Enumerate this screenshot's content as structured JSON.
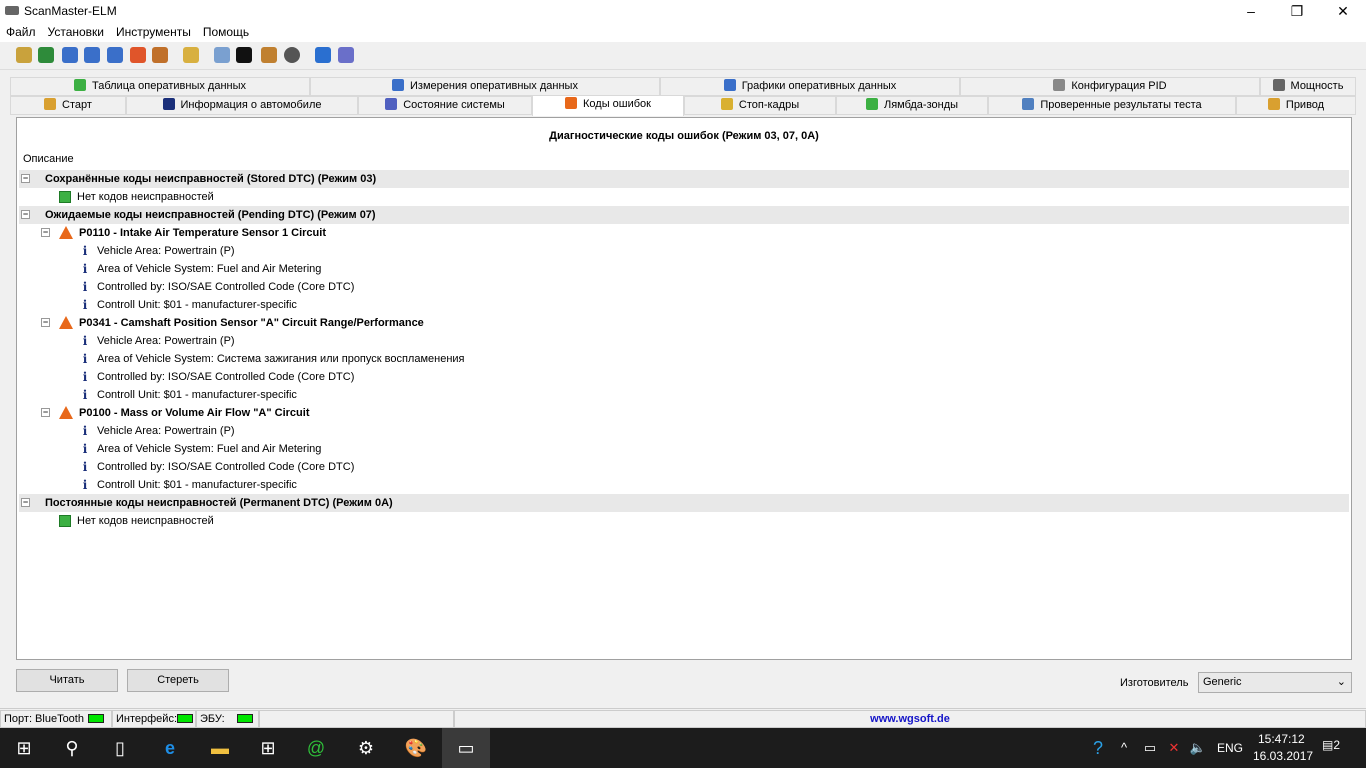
{
  "window": {
    "title": "ScanMaster-ELM",
    "minimize": "–",
    "maximize": "❐",
    "close": "✕"
  },
  "menu": [
    "Файл",
    "Установки",
    "Инструменты",
    "Помощь"
  ],
  "toolbar_icons": [
    "connect-icon",
    "globe-icon",
    "report-icon",
    "table-icon",
    "chart-icon",
    "windows-icon",
    "user-icon",
    "clipboard-icon",
    "search-icon",
    "terminal-icon",
    "phone-icon",
    "gauge-icon",
    "info-icon",
    "exit-icon"
  ],
  "tabs_row1": [
    "Таблица оперативных данных",
    "Измерения оперативных данных",
    "Графики оперативных данных",
    "Конфигурация PID",
    "Мощность"
  ],
  "tabs_row2": [
    "Старт",
    "Информация о автомобиле",
    "Состояние системы",
    "Коды ошибок",
    "Стоп-кадры",
    "Лямбда-зонды",
    "Проверенные результаты теста",
    "Привод"
  ],
  "panel": {
    "title": "Диагностические коды ошибок (Режим 03, 07, 0A)",
    "column": "Описание"
  },
  "tree": [
    {
      "kind": "grp",
      "level": 0,
      "text": "Сохранённые коды неисправностей (Stored DTC) (Режим 03)"
    },
    {
      "kind": "ok",
      "level": 1,
      "text": "Нет кодов неисправностей"
    },
    {
      "kind": "grp",
      "level": 0,
      "text": "Ожидаемые коды неисправностей (Pending DTC) (Режим 07)"
    },
    {
      "kind": "dtc",
      "level": 1,
      "text": "P0110 - Intake Air Temperature Sensor 1 Circuit"
    },
    {
      "kind": "info",
      "level": 2,
      "text": "Vehicle Area: Powertrain (P)"
    },
    {
      "kind": "info",
      "level": 2,
      "text": "Area of Vehicle System: Fuel and Air Metering"
    },
    {
      "kind": "info",
      "level": 2,
      "text": "Controlled by: ISO/SAE Controlled Code (Core DTC)"
    },
    {
      "kind": "info",
      "level": 2,
      "text": "Controll Unit: $01 - manufacturer-specific"
    },
    {
      "kind": "dtc",
      "level": 1,
      "text": "P0341 - Camshaft Position Sensor \"A\" Circuit Range/Performance"
    },
    {
      "kind": "info",
      "level": 2,
      "text": "Vehicle Area: Powertrain (P)"
    },
    {
      "kind": "info",
      "level": 2,
      "text": "Area of Vehicle System: Система зажигания или пропуск воспламенения"
    },
    {
      "kind": "info",
      "level": 2,
      "text": "Controlled by: ISO/SAE Controlled Code (Core DTC)"
    },
    {
      "kind": "info",
      "level": 2,
      "text": "Controll Unit: $01 - manufacturer-specific"
    },
    {
      "kind": "dtc",
      "level": 1,
      "text": "P0100 - Mass or Volume Air Flow \"A\" Circuit"
    },
    {
      "kind": "info",
      "level": 2,
      "text": "Vehicle Area: Powertrain (P)"
    },
    {
      "kind": "info",
      "level": 2,
      "text": "Area of Vehicle System: Fuel and Air Metering"
    },
    {
      "kind": "info",
      "level": 2,
      "text": "Controlled by: ISO/SAE Controlled Code (Core DTC)"
    },
    {
      "kind": "info",
      "level": 2,
      "text": "Controll Unit: $01 - manufacturer-specific"
    },
    {
      "kind": "grp",
      "level": 0,
      "text": "Постоянные коды неисправностей (Permanent DTC) (Режим 0A)"
    },
    {
      "kind": "ok",
      "level": 1,
      "text": "Нет кодов неисправностей"
    }
  ],
  "buttons": {
    "read": "Читать",
    "clear": "Стереть"
  },
  "manufacturer": {
    "label": "Изготовитель",
    "value": "Generic"
  },
  "status": {
    "port": "Порт: BlueTooth",
    "iface": "Интерфейс:",
    "ecu": "ЭБУ:",
    "site": "www.wgsoft.de"
  },
  "taskbar": {
    "lang": "ENG",
    "time": "15:47:12",
    "date": "16.03.2017",
    "notifications": "2"
  }
}
